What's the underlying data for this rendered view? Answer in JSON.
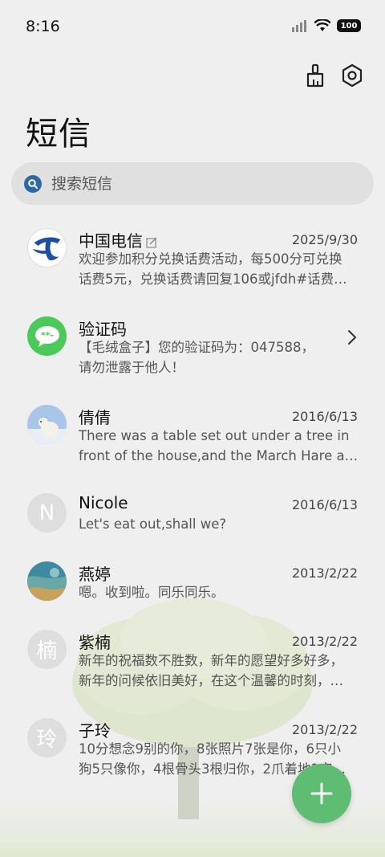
{
  "status": {
    "time": "8:16",
    "battery": "100"
  },
  "header": {
    "title": "短信"
  },
  "search": {
    "placeholder": "搜索短信"
  },
  "colors": {
    "accent_green": "#5ebd72",
    "search_blue": "#2d6aa5",
    "telecom_blue": "#1f4fa3",
    "message_green": "#4bc95b"
  },
  "conversations": [
    {
      "name": "中国电信",
      "date": "2025/9/30",
      "line1": "欢迎参加积分兑换话费活动，每500分可兑换",
      "line2": "话费5元，兑换话费请回复106或jfdh#话费…",
      "avatar": "china-telecom-logo",
      "has_edit_icon": true
    },
    {
      "name": "验证码",
      "date": "",
      "line1": "【毛绒盒子】您的验证码为：047588，",
      "line2": "请勿泄露于他人！",
      "avatar": "message-bubble-icon"
    },
    {
      "name": "倩倩",
      "date": "2016/6/13",
      "line1": "There was a table set out under a tree in",
      "line2": "front of the house,and the March Hare an…",
      "avatar": "polar-bear-photo"
    },
    {
      "name": "Nicole",
      "date": "2016/6/13",
      "line1": "Let's eat out,shall we?",
      "line2": "",
      "avatar_letter": "N"
    },
    {
      "name": "燕婷",
      "date": "2013/2/22",
      "line1": "嗯。收到啦。同乐同乐。",
      "line2": "",
      "avatar": "landscape-photo"
    },
    {
      "name": "紫楠",
      "date": "2013/2/22",
      "line1": "新年的祝福数不胜数，新年的愿望好多好多，",
      "line2": "新年的问候依旧美好，在这个温馨的时刻，…",
      "avatar_letter": "楠"
    },
    {
      "name": "子玲",
      "date": "2013/2/22",
      "line1": "10分想念9别的你，8张照片7张是你，6只小",
      "line2": "狗5只像你，4根骨头3根归你，2爪着地1定…",
      "avatar_letter": "玲"
    }
  ],
  "fab": {
    "icon": "plus-icon"
  }
}
